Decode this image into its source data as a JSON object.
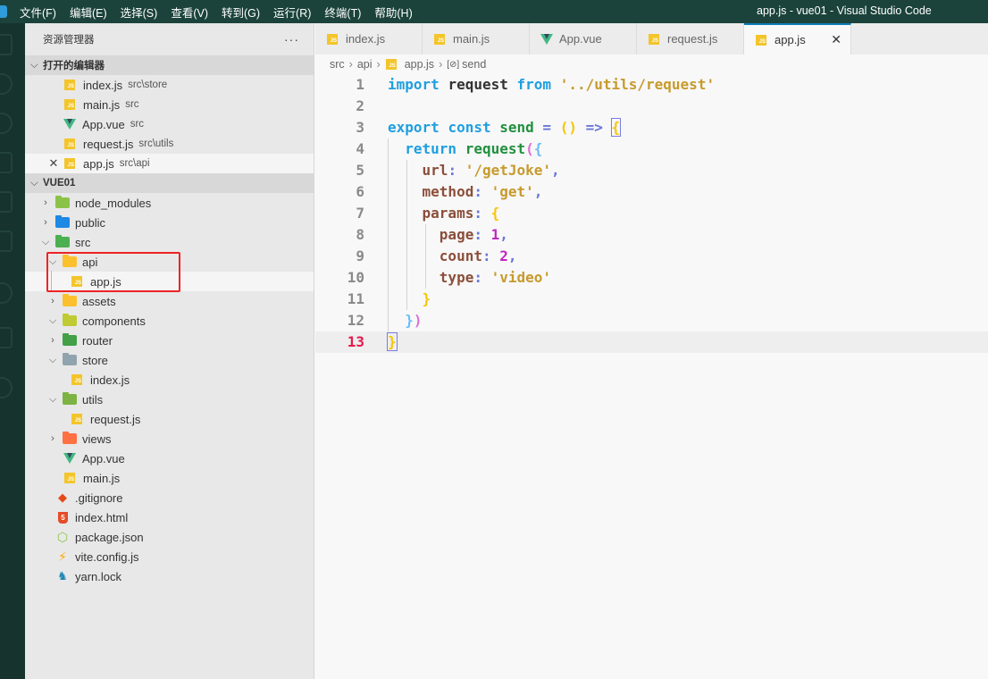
{
  "window": {
    "title": "app.js - vue01 - Visual Studio Code",
    "menu": [
      "文件(F)",
      "编辑(E)",
      "选择(S)",
      "查看(V)",
      "转到(G)",
      "运行(R)",
      "终端(T)",
      "帮助(H)"
    ]
  },
  "sidebar": {
    "title": "资源管理器",
    "more_icon": "ellipsis-icon",
    "open_editors": {
      "label": "打开的编辑器",
      "items": [
        {
          "name": "index.js",
          "desc": "src\\store",
          "icon": "js-icon"
        },
        {
          "name": "main.js",
          "desc": "src",
          "icon": "js-icon"
        },
        {
          "name": "App.vue",
          "desc": "src",
          "icon": "vue-icon"
        },
        {
          "name": "request.js",
          "desc": "src\\utils",
          "icon": "js-icon"
        },
        {
          "name": "app.js",
          "desc": "src\\api",
          "icon": "js-icon",
          "active": true
        }
      ]
    },
    "project": {
      "label": "VUE01",
      "tree": [
        {
          "name": "node_modules",
          "type": "folder",
          "expanded": false,
          "color": "#8bc34a"
        },
        {
          "name": "public",
          "type": "folder",
          "expanded": false,
          "color": "#1e88e5"
        },
        {
          "name": "src",
          "type": "folder",
          "expanded": true,
          "color": "#4caf50"
        },
        {
          "name": "api",
          "type": "folder",
          "expanded": true,
          "color": "#fbc02d"
        },
        {
          "name": "app.js",
          "type": "file",
          "icon": "js-icon",
          "selected": true
        },
        {
          "name": "assets",
          "type": "folder",
          "expanded": false,
          "color": "#fbc02d"
        },
        {
          "name": "components",
          "type": "folder",
          "expanded": true,
          "color": "#c0ca33"
        },
        {
          "name": "router",
          "type": "folder",
          "expanded": false,
          "color": "#43a047"
        },
        {
          "name": "store",
          "type": "folder",
          "expanded": true,
          "color": "#90a4ae"
        },
        {
          "name": "index.js",
          "type": "file",
          "icon": "js-icon"
        },
        {
          "name": "utils",
          "type": "folder",
          "expanded": true,
          "color": "#7cb342"
        },
        {
          "name": "request.js",
          "type": "file",
          "icon": "js-icon"
        },
        {
          "name": "views",
          "type": "folder",
          "expanded": false,
          "color": "#ff7043"
        },
        {
          "name": "App.vue",
          "type": "file",
          "icon": "vue-icon"
        },
        {
          "name": "main.js",
          "type": "file",
          "icon": "js-icon"
        },
        {
          "name": ".gitignore",
          "type": "file",
          "icon": "git-icon"
        },
        {
          "name": "index.html",
          "type": "file",
          "icon": "html-icon"
        },
        {
          "name": "package.json",
          "type": "file",
          "icon": "nodejs-icon"
        },
        {
          "name": "vite.config.js",
          "type": "file",
          "icon": "vite-icon"
        },
        {
          "name": "yarn.lock",
          "type": "file",
          "icon": "yarn-icon"
        }
      ]
    }
  },
  "editor": {
    "tabs": [
      {
        "label": "index.js",
        "icon": "js-icon"
      },
      {
        "label": "main.js",
        "icon": "js-icon"
      },
      {
        "label": "App.vue",
        "icon": "vue-icon"
      },
      {
        "label": "request.js",
        "icon": "js-icon"
      },
      {
        "label": "app.js",
        "icon": "js-icon",
        "active": true
      }
    ],
    "breadcrumb": [
      "src",
      "api",
      "app.js",
      "send"
    ],
    "current_line": 13,
    "lines": [
      {
        "n": "1",
        "code": "import request from '../utils/request'"
      },
      {
        "n": "2",
        "code": ""
      },
      {
        "n": "3",
        "code": "export const send = () => {"
      },
      {
        "n": "4",
        "code": "  return request({"
      },
      {
        "n": "5",
        "code": "    url: '/getJoke',"
      },
      {
        "n": "6",
        "code": "    method: 'get',"
      },
      {
        "n": "7",
        "code": "    params: {"
      },
      {
        "n": "8",
        "code": "      page: 1,"
      },
      {
        "n": "9",
        "code": "      count: 2,"
      },
      {
        "n": "10",
        "code": "      type: 'video'"
      },
      {
        "n": "11",
        "code": "    }"
      },
      {
        "n": "12",
        "code": "  })"
      },
      {
        "n": "13",
        "code": "}"
      }
    ]
  },
  "colors": {
    "titlebar": "#1b433b",
    "activitybar": "#16332e",
    "tab_active_border": "#0d7bb8",
    "highlight_box": "#ef2323"
  }
}
